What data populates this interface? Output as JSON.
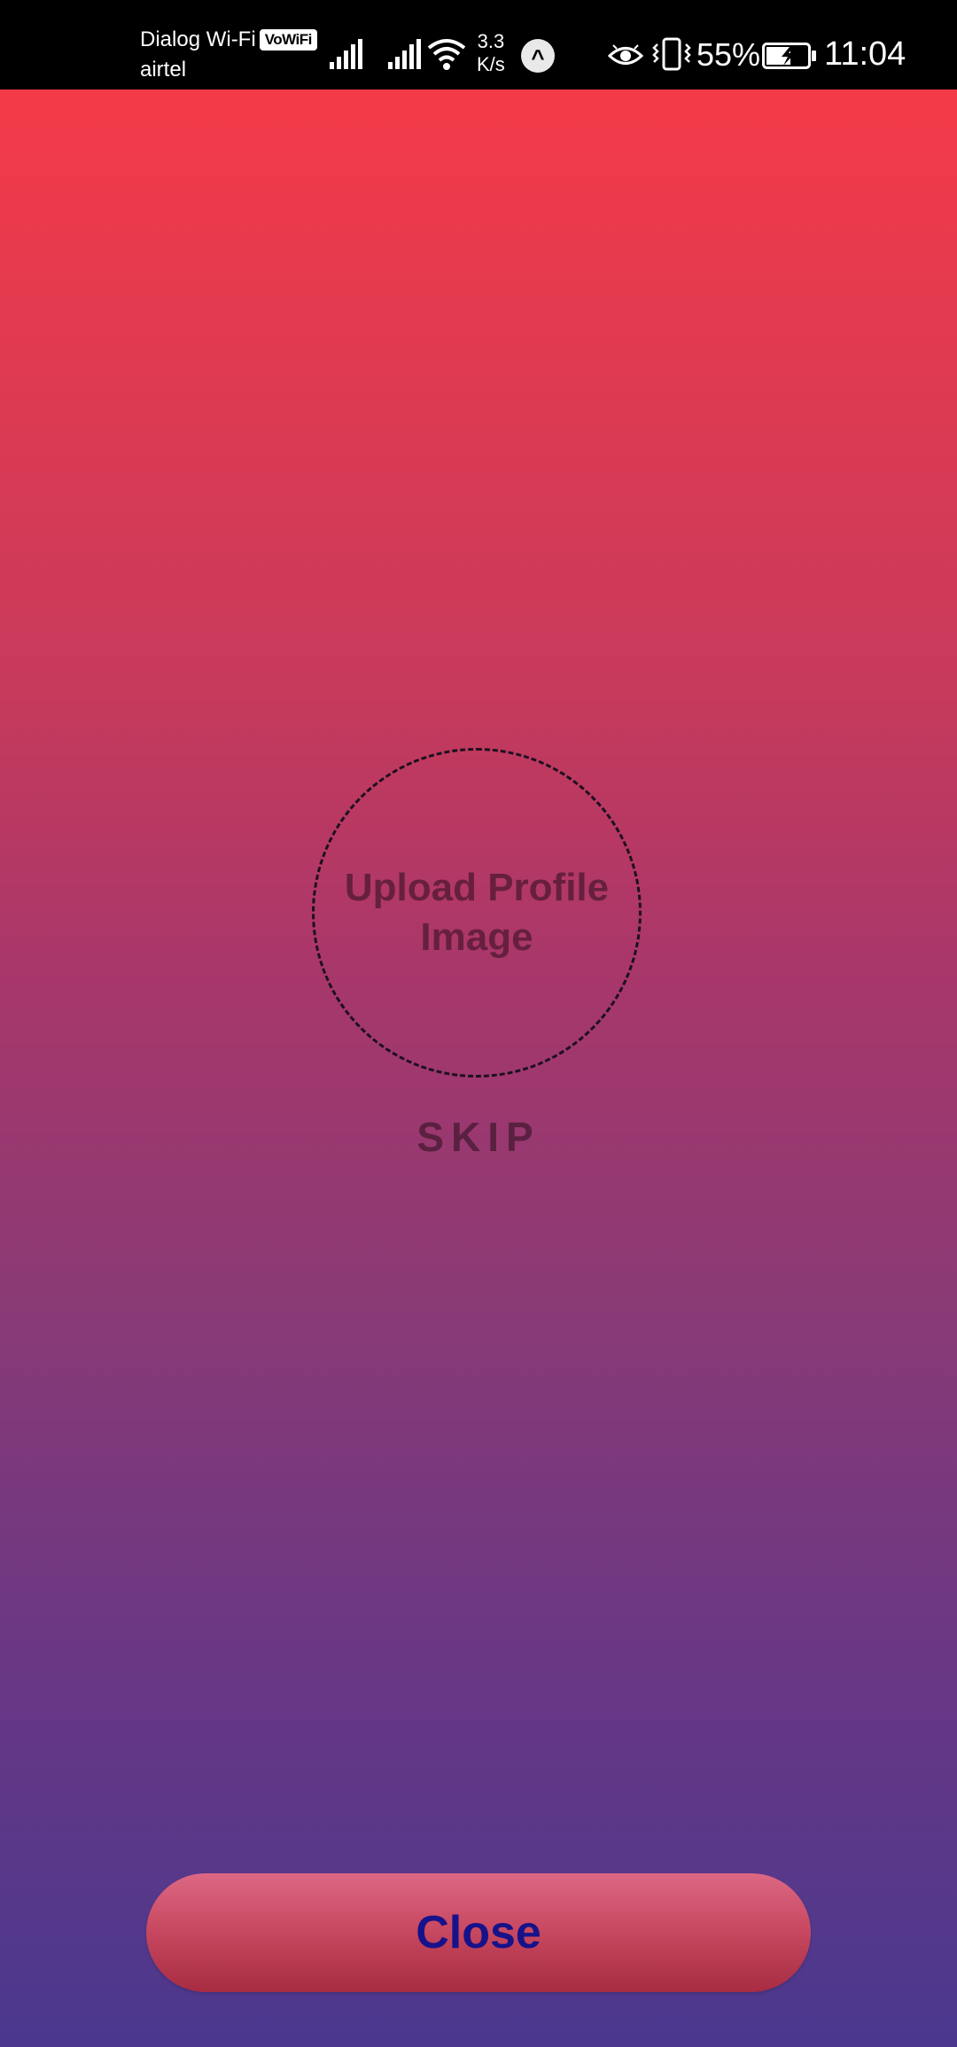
{
  "status_bar": {
    "carrier_primary": "Dialog Wi-Fi",
    "vowifi_badge": "VoWiFi",
    "carrier_secondary": "airtel",
    "network_speed_value": "3.3",
    "network_speed_unit": "K/s",
    "notification_app_glyph": "^",
    "battery_percent": "55%",
    "time": "11:04",
    "icons": [
      "signal-1-icon",
      "signal-2-icon",
      "wifi-icon",
      "app-notification-icon",
      "eye-comfort-icon",
      "vibrate-icon",
      "battery-charging-icon"
    ]
  },
  "profile": {
    "upload_label": "Upload Profile\nImage",
    "skip_label": "SKIP"
  },
  "footer": {
    "close_label": "Close"
  },
  "colors": {
    "gradient_top": "#f43a48",
    "gradient_bottom": "#4a388e",
    "close_text": "#17128a",
    "upload_text": "#66203e"
  }
}
